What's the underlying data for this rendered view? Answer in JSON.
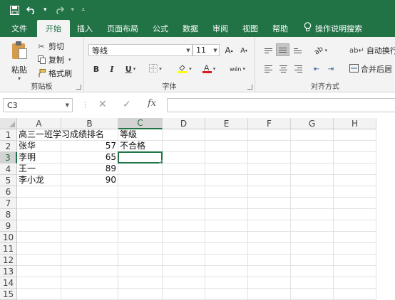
{
  "quick_access": {
    "save_icon": "save-icon",
    "undo_icon": "undo-icon",
    "redo_icon": "redo-icon",
    "customize_icon": "customize-qat-icon"
  },
  "tabs": [
    {
      "label": "文件",
      "active": false
    },
    {
      "label": "开始",
      "active": true
    },
    {
      "label": "插入",
      "active": false
    },
    {
      "label": "页面布局",
      "active": false
    },
    {
      "label": "公式",
      "active": false
    },
    {
      "label": "数据",
      "active": false
    },
    {
      "label": "审阅",
      "active": false
    },
    {
      "label": "视图",
      "active": false
    },
    {
      "label": "帮助",
      "active": false
    }
  ],
  "tell_me": "操作说明搜索",
  "ribbon": {
    "clipboard": {
      "paste": "粘贴",
      "cut": "剪切",
      "copy": "复制",
      "format_painter": "格式刷",
      "group_label": "剪贴板"
    },
    "font": {
      "font_name": "等线",
      "font_size": "11",
      "grow": "A",
      "shrink": "A",
      "bold": "B",
      "italic": "I",
      "underline": "U",
      "phonetic": "wén",
      "group_label": "字体"
    },
    "alignment": {
      "wrap_text": "自动换行",
      "merge_center": "合并后居",
      "group_label": "对齐方式"
    }
  },
  "formula_bar": {
    "name_box": "C3",
    "fx": "fx",
    "content": ""
  },
  "sheet": {
    "columns": [
      "A",
      "B",
      "C",
      "D",
      "E",
      "F",
      "G",
      "H"
    ],
    "rows": [
      "1",
      "2",
      "3",
      "4",
      "5",
      "6",
      "7",
      "8",
      "9",
      "10",
      "11",
      "12",
      "13",
      "14",
      "15"
    ],
    "selected_column": "C",
    "selected_row": "3",
    "cells": [
      {
        "ref": "A1",
        "value": "高三一班学习成绩排名",
        "type": "text"
      },
      {
        "ref": "C1",
        "value": "等级",
        "type": "text"
      },
      {
        "ref": "A2",
        "value": "张华",
        "type": "text"
      },
      {
        "ref": "B2",
        "value": "57",
        "type": "num"
      },
      {
        "ref": "C2",
        "value": "不合格",
        "type": "text"
      },
      {
        "ref": "A3",
        "value": "李明",
        "type": "text"
      },
      {
        "ref": "B3",
        "value": "65",
        "type": "num"
      },
      {
        "ref": "A4",
        "value": "王一",
        "type": "text"
      },
      {
        "ref": "B4",
        "value": "89",
        "type": "num"
      },
      {
        "ref": "A5",
        "value": "李小龙",
        "type": "text"
      },
      {
        "ref": "B5",
        "value": "90",
        "type": "num"
      }
    ]
  },
  "colors": {
    "accent": "#217346",
    "ribbon_bg": "#f3f3f3",
    "header_bg": "#f3f3f3",
    "selected_header_bg": "#d3d3d3"
  }
}
